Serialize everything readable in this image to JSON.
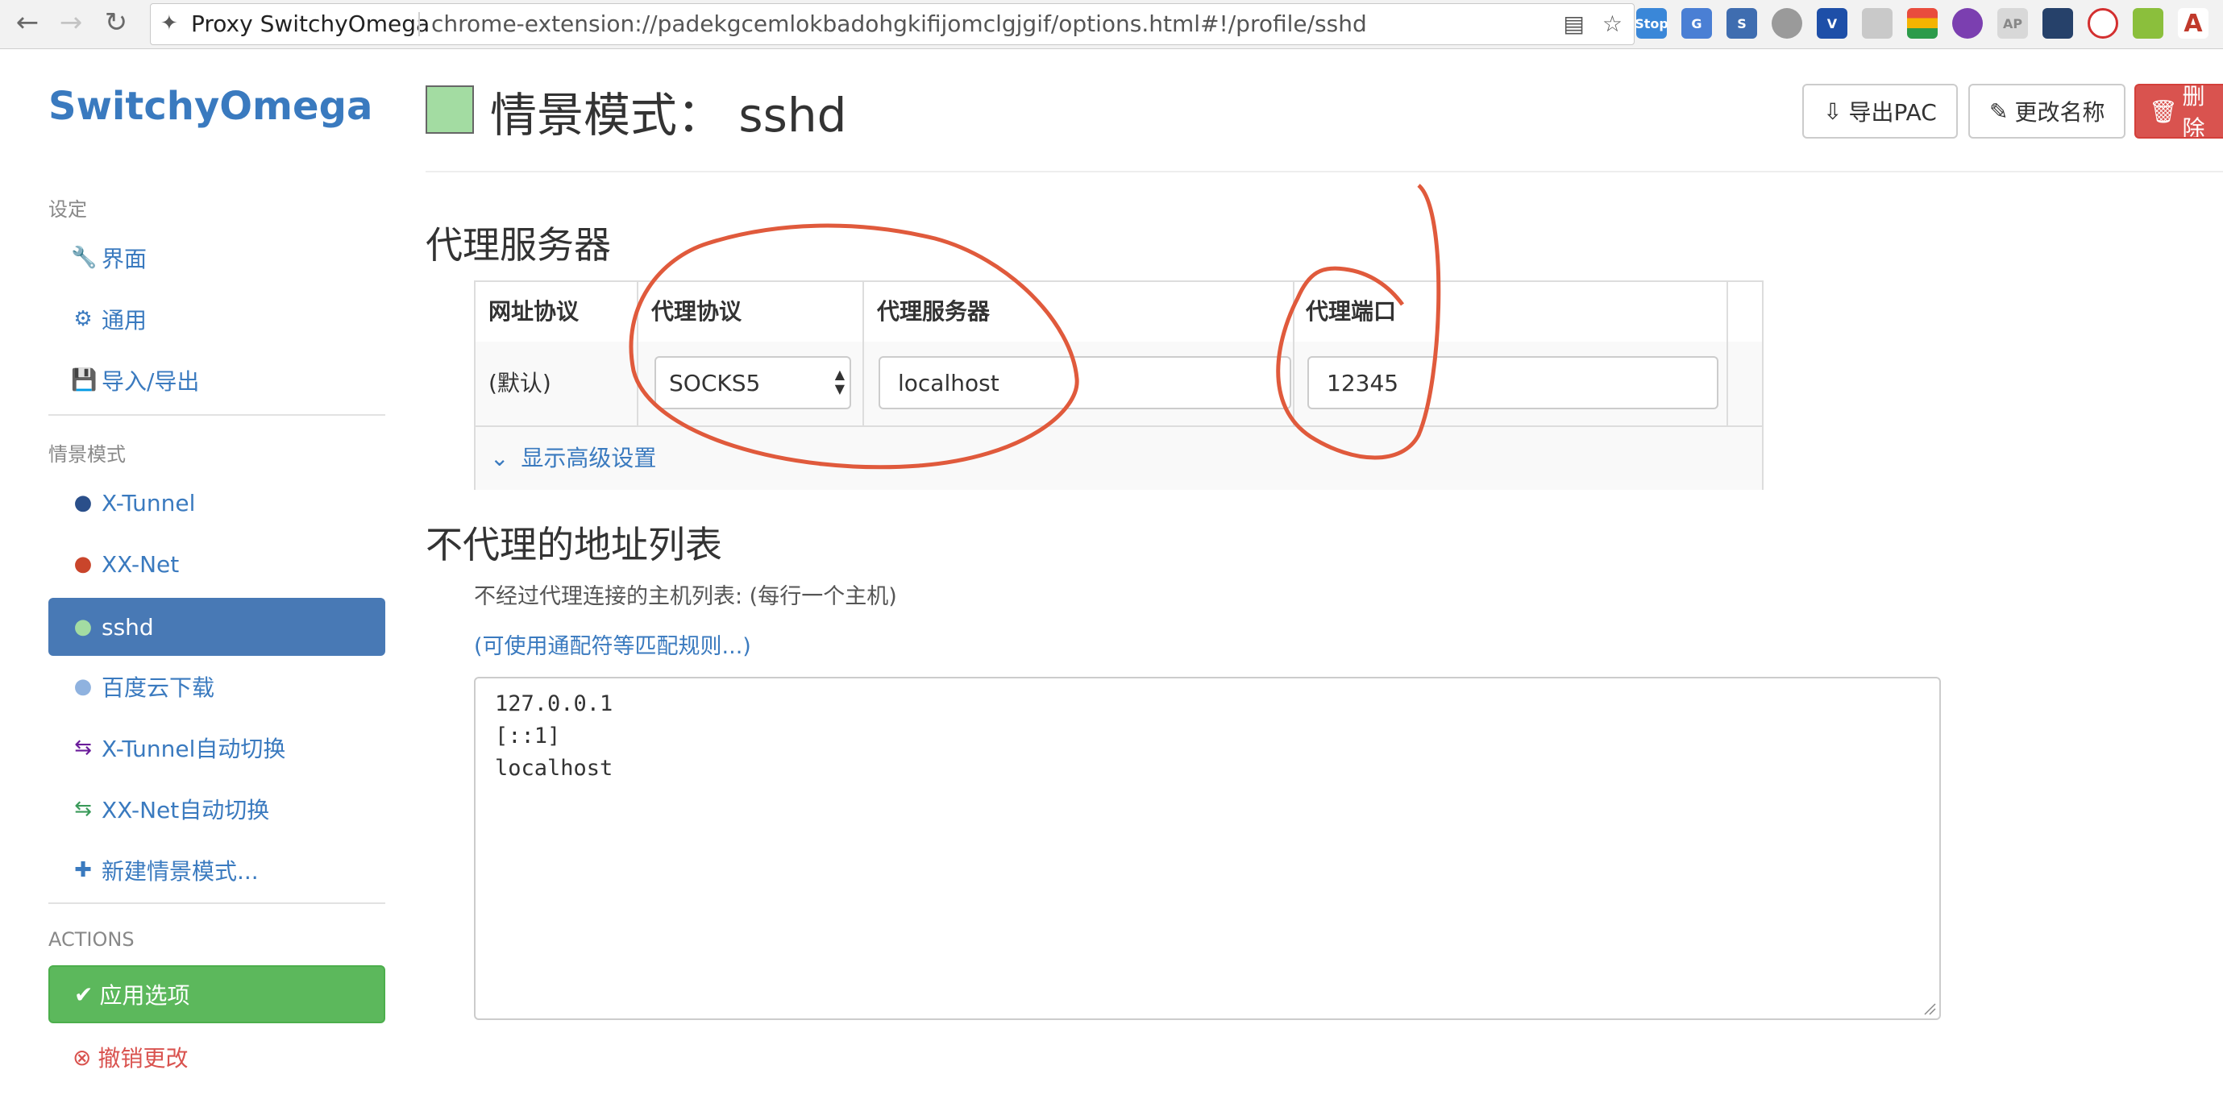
{
  "browser": {
    "tab_title": "Proxy SwitchyOmega",
    "url": "chrome-extension://padekgcemlokbadohgkifijomclgjgif/options.html#!/profile/sshd",
    "ext_labels": [
      "Stop",
      "G",
      "S",
      "",
      "V",
      "",
      "",
      "",
      "AP",
      "",
      "",
      "",
      "A"
    ]
  },
  "sidebar": {
    "brand": "SwitchyOmega",
    "settings_header": "设定",
    "settings_items": [
      {
        "label": "界面",
        "icon": "wrench-icon"
      },
      {
        "label": "通用",
        "icon": "gear-icon"
      },
      {
        "label": "导入/导出",
        "icon": "floppy-icon"
      }
    ],
    "profiles_header": "情景模式",
    "profiles": [
      {
        "label": "X-Tunnel",
        "icon": "globe-icon",
        "color": "#2a4f8a"
      },
      {
        "label": "XX-Net",
        "icon": "globe-icon",
        "color": "#c9452b"
      },
      {
        "label": "sshd",
        "icon": "globe-icon",
        "color": "#a3dca2"
      },
      {
        "label": "百度云下载",
        "icon": "globe-icon",
        "color": "#8fb2df"
      },
      {
        "label": "X-Tunnel自动切换",
        "icon": "switch-icon",
        "color": "#6a1b9a"
      },
      {
        "label": "XX-Net自动切换",
        "icon": "switch-icon",
        "color": "#3a9a5a"
      },
      {
        "label": "新建情景模式...",
        "icon": "plus-icon",
        "color": "#3a7abf"
      }
    ],
    "actions_header": "ACTIONS",
    "apply_label": "应用选项",
    "discard_label": "撤销更改"
  },
  "header": {
    "title": "情景模式： sshd",
    "swatch_color": "#a3dca2",
    "export_pac": "导出PAC",
    "rename": "更改名称",
    "delete": "删除"
  },
  "proxy": {
    "section_title": "代理服务器",
    "columns": [
      "网址协议",
      "代理协议",
      "代理服务器",
      "代理端口"
    ],
    "row_scheme": "(默认)",
    "protocol": "SOCKS5",
    "server": "localhost",
    "port": "12345",
    "advanced_link": "显示高级设置"
  },
  "bypass": {
    "section_title": "不代理的地址列表",
    "help": "不经过代理连接的主机列表: (每行一个主机)",
    "wildcard_link": "(可使用通配符等匹配规则...)",
    "entries": [
      "127.0.0.1",
      "[::1]",
      "localhost"
    ]
  }
}
